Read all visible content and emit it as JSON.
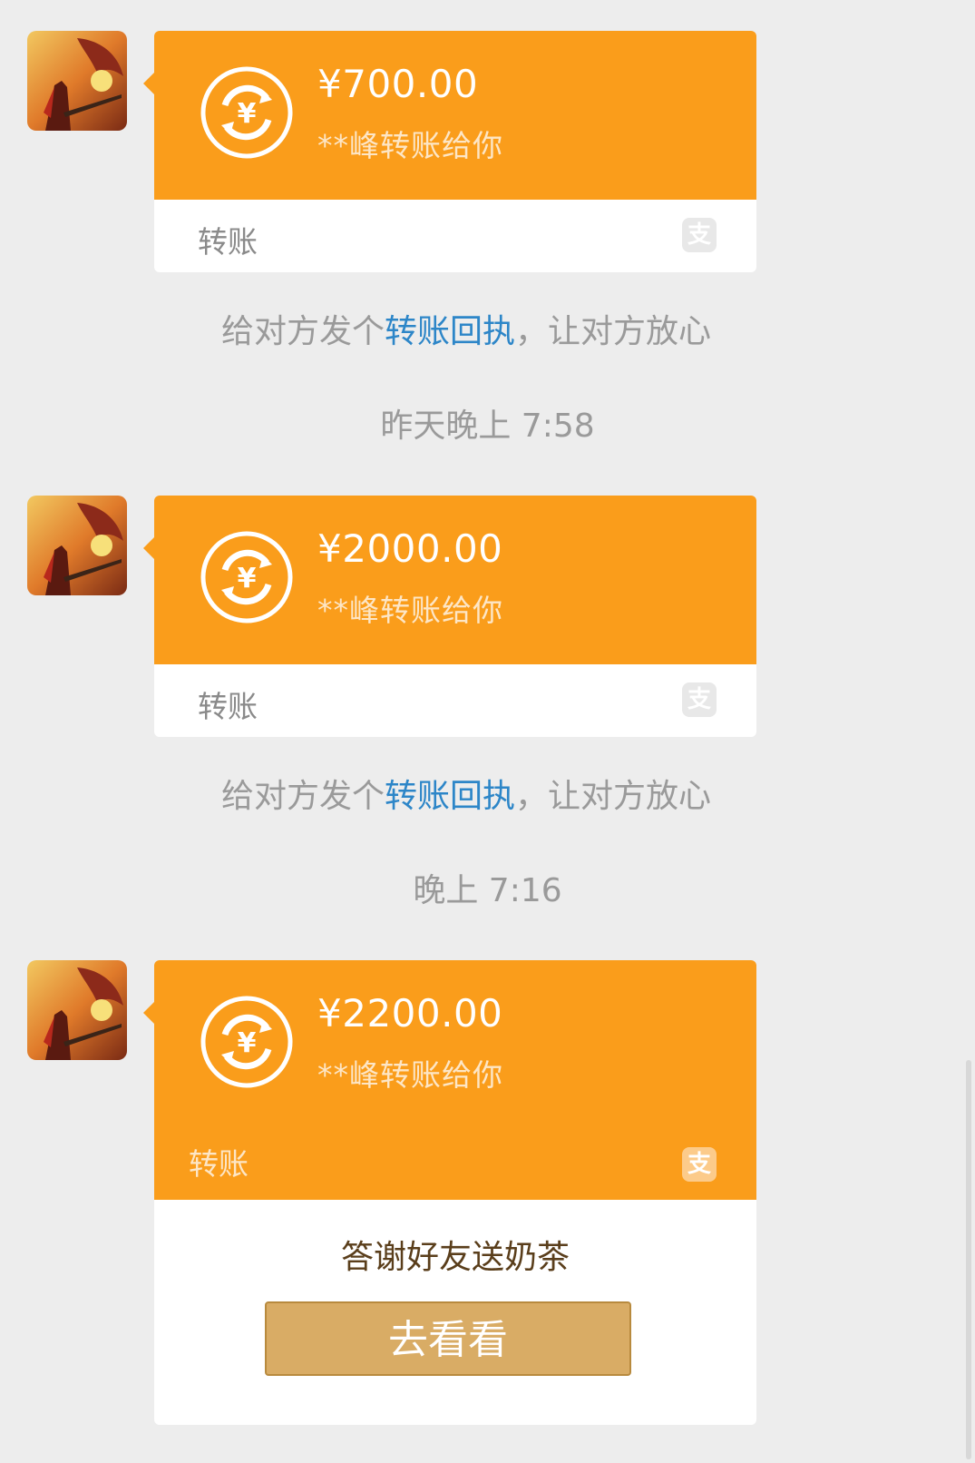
{
  "messages": [
    {
      "amount": "¥700.00",
      "from_text": "**峰转账给你",
      "footer_label": "转账",
      "pay_icon": "alipay-icon"
    },
    {
      "amount": "¥2000.00",
      "from_text": "**峰转账给你",
      "footer_label": "转账",
      "pay_icon": "alipay-icon"
    },
    {
      "amount": "¥2200.00",
      "from_text": "**峰转账给你",
      "footer_label": "转账",
      "pay_icon": "alipay-icon",
      "promo_text": "答谢好友送奶茶",
      "promo_button": "去看看"
    }
  ],
  "receipts": [
    {
      "before": "给对方发个",
      "link": "转账回执",
      "after": "，让对方放心"
    },
    {
      "before": "给对方发个",
      "link": "转账回执",
      "after": "，让对方放心"
    }
  ],
  "timestamps": [
    "昨天晚上 7:58",
    "晚上 7:16"
  ],
  "pay_glyph": "支",
  "colors": {
    "bubble_orange": "#fa9d1b",
    "link_blue": "#2d86c8",
    "promo_button": "#d9ac65",
    "background": "#ededed"
  }
}
